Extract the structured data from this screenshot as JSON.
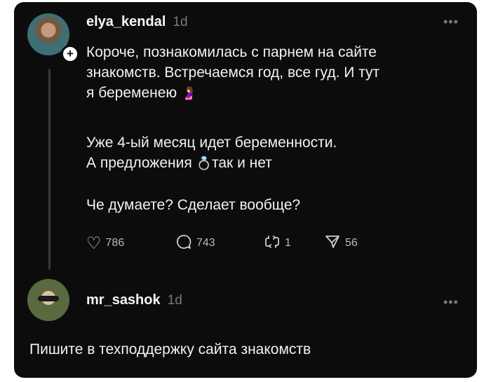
{
  "post": {
    "username": "elya_kendal",
    "time": "1d",
    "more": "•••",
    "plus": "+",
    "lines": [
      "Короче, познакомилась с парнем на сайте",
      "знакомств. Встречаемся год, все гуд. И тут",
      "я беременею",
      "Уже 4-ый месяц идет беременности.",
      "А предложения",
      "так и нет",
      "Че думаете? Сделает вообще?"
    ],
    "emoji_pregnant": "🤰",
    "emoji_ring": "💍",
    "likes": "786",
    "comments": "743",
    "reposts": "1",
    "shares": "56",
    "icons": {
      "like": "heart-icon",
      "comment": "comment-bubble-icon",
      "repost": "repost-icon",
      "share": "send-icon"
    }
  },
  "reply": {
    "username": "mr_sashok",
    "time": "1d",
    "more": "•••",
    "text": "Пишите в техподдержку сайта знакомств"
  }
}
